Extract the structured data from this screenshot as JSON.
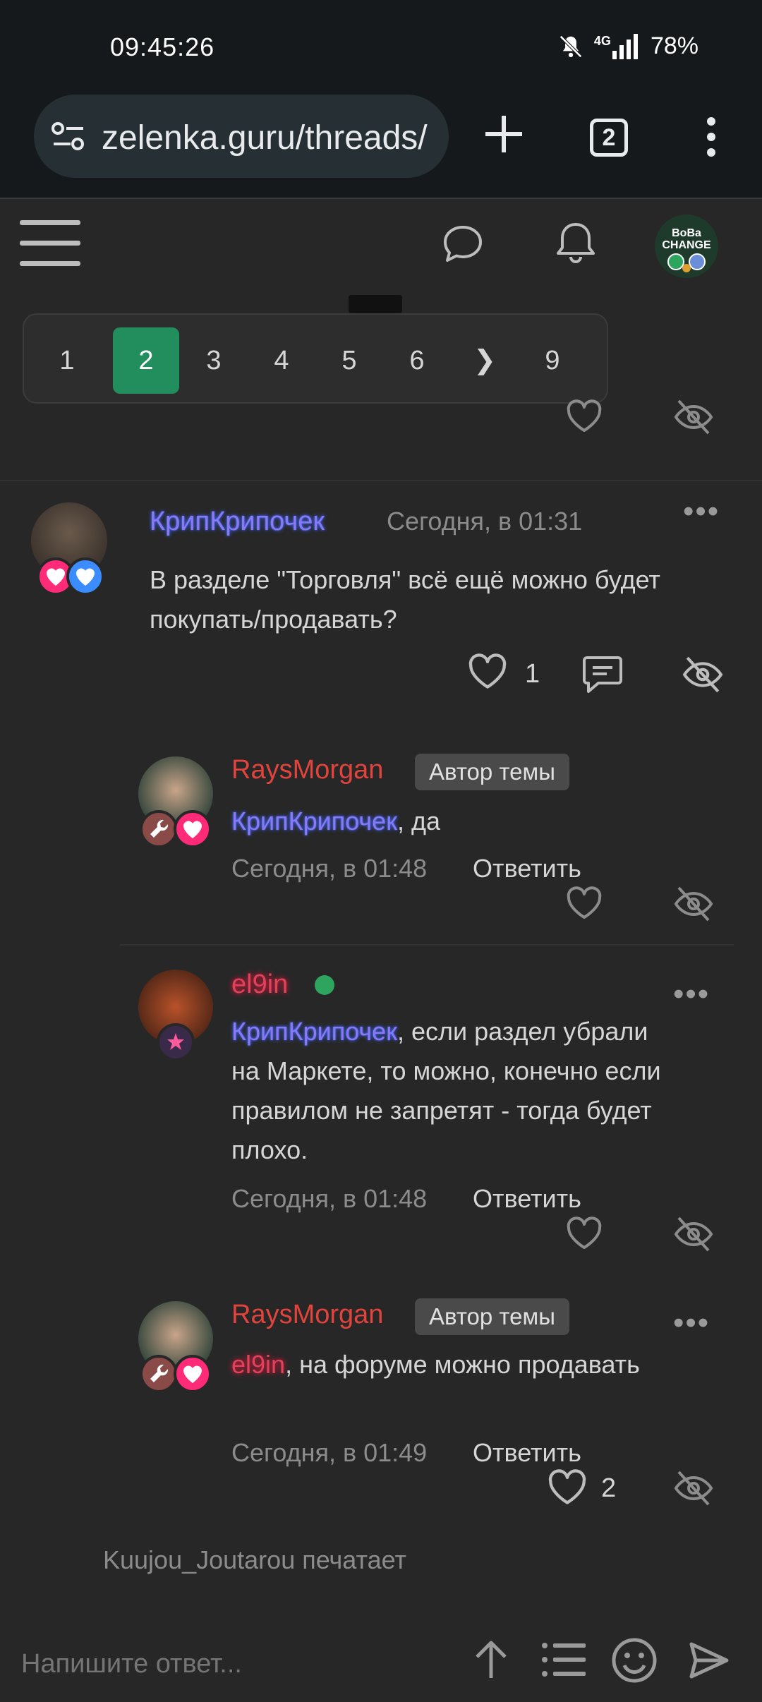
{
  "status_bar": {
    "time": "09:45:26",
    "network": "4G",
    "battery": "78%"
  },
  "browser": {
    "url": "zelenka.guru/threads/",
    "tab_count": "2"
  },
  "header": {
    "avatar_line1": "BoBa",
    "avatar_line2": "CHANGE"
  },
  "pagination": {
    "pages": [
      "1",
      "2",
      "3",
      "4",
      "5",
      "6",
      "❯",
      "9"
    ],
    "current": "2"
  },
  "posts": [
    {
      "username": "КрипКрипочек",
      "time": "Сегодня, в 01:31",
      "text": "В разделе \"Торговля\" всё ещё можно будет покупать/продавать?",
      "likes": "1"
    }
  ],
  "replies": [
    {
      "username": "RaysMorgan",
      "tag": "Автор темы",
      "mention": "КрипКрипочек",
      "text": ", да",
      "time": "Сегодня, в 01:48",
      "reply_label": "Ответить"
    },
    {
      "username": "el9in",
      "mention": "КрипКрипочек",
      "text": ", если раздел убрали на Маркете, то можно, конечно если правилом не запретят - тогда будет плохо.",
      "time": "Сегодня, в 01:48",
      "reply_label": "Ответить"
    },
    {
      "username": "RaysMorgan",
      "tag": "Автор темы",
      "mention": "el9in",
      "text": ", на форуме можно продавать",
      "time": "Сегодня, в 01:49",
      "reply_label": "Ответить",
      "likes": "2"
    }
  ],
  "typing_indicator": "Kuujou_Joutarou печатает",
  "composer": {
    "placeholder": "Напишите ответ..."
  },
  "colors": {
    "accent_green": "#228e5d",
    "background": "#272727",
    "online_dot": "#2ea55e"
  }
}
